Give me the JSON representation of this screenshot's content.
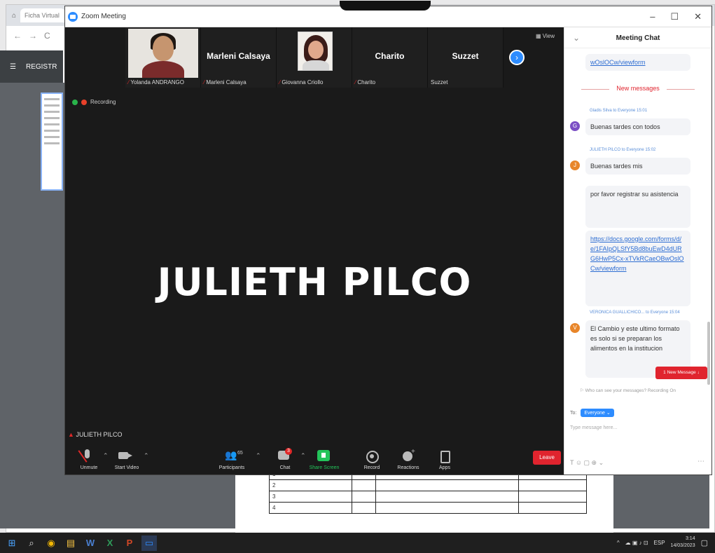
{
  "browser": {
    "tab_label": "Ficha Virtual",
    "nav_back": "←",
    "nav_forward": "→",
    "nav_reload": "C",
    "app_bar_menu": "☰",
    "app_bar_title": "REGISTR"
  },
  "zoom": {
    "title": "Zoom Meeting",
    "view_label": "View",
    "recording_label": "Recording",
    "next_page": "›",
    "speaker_name": "JULIETH PILCO",
    "self_label": "JULIETH PILCO"
  },
  "gallery": [
    {
      "display_name": "",
      "caption": "Yolanda ANDRANGO",
      "has_video": true
    },
    {
      "display_name": "Marleni Calsaya",
      "caption": "Marleni Calsaya",
      "has_video": false
    },
    {
      "display_name": "",
      "caption": "Giovanna Criollo",
      "has_video": true
    },
    {
      "display_name": "Charito",
      "caption": "Charito",
      "has_video": false
    },
    {
      "display_name": "Suzzet",
      "caption": "Suzzet",
      "has_video": false
    }
  ],
  "toolbar": {
    "unmute": "Unmute",
    "start_video": "Start Video",
    "participants": "Participants",
    "participants_count": "65",
    "chat": "Chat",
    "share_screen": "Share Screen",
    "record": "Record",
    "reactions": "Reactions",
    "apps": "Apps",
    "leave": "Leave"
  },
  "chat": {
    "title": "Meeting Chat",
    "collapse_icon": "⌄",
    "prev_link_tail": "wOslOCw/viewform",
    "new_messages_label": "New messages",
    "messages": [
      {
        "sender": "Gladis Silva to Everyone 15:01",
        "avatar_letter": "G",
        "avatar_color": "#7b4fc4",
        "text": "Buenas tardes con todos"
      },
      {
        "sender": "JULIETH PILCO to Everyone 15:02",
        "avatar_letter": "J",
        "avatar_color": "#e8862a",
        "text": "Buenas tardes mis"
      },
      {
        "sender": "",
        "avatar_letter": "",
        "avatar_color": "",
        "text": "por favor registrar su asistencia"
      },
      {
        "sender": "",
        "avatar_letter": "",
        "avatar_color": "",
        "link": "https://docs.google.com/forms/d/e/1FAIpQLSfY5Bd8buEwD4dURG6HwP5Cx-xTVkRCaeOBwOslOCw/viewform"
      },
      {
        "sender": "VERONICA GUALLICHICO... to Everyone 15:04",
        "avatar_letter": "V",
        "avatar_color": "#e8862a",
        "text": "El Cambio y este ultimo formato es solo si se preparan los alimentos en la institucion"
      }
    ],
    "unread_button": "1 New Message ↓",
    "who_can_see": "Who can see your messages? Recording On",
    "to_label": "To:",
    "to_chip": "Everyone ⌄",
    "input_placeholder": "Type message here...",
    "tool_icons": "T ☺ ▢ ⊕ ⌄",
    "more_icon": "⋯"
  },
  "bg_table_cells": [
    "1",
    "2",
    "3",
    "4"
  ],
  "taskbar": {
    "time": "3:14",
    "date": "14/03/2023",
    "lang": "ESP",
    "start_icon": "⊞",
    "search_icon": "⌕",
    "chrome_icon": "◉",
    "explorer_icon": "▤",
    "word_icon": "W",
    "excel_icon": "X",
    "powerpoint_icon": "P",
    "zoom_icon": "▭",
    "tray_up_icon": "^",
    "tray_icons": "☁ ▣ ♪ ⊡",
    "notification_icon": "▢"
  }
}
